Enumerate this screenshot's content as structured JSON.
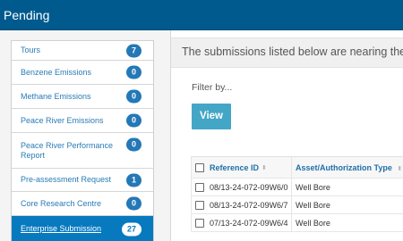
{
  "header": {
    "title": "Pending"
  },
  "sidebar": {
    "items": [
      {
        "label": "Tours",
        "count": "7",
        "active": false
      },
      {
        "label": "Benzene Emissions",
        "count": "0",
        "active": false
      },
      {
        "label": "Methane Emissions",
        "count": "0",
        "active": false
      },
      {
        "label": "Peace River Emissions",
        "count": "0",
        "active": false
      },
      {
        "label": "Peace River Performance Report",
        "count": "0",
        "active": false
      },
      {
        "label": "Pre-assessment Request",
        "count": "1",
        "active": false
      },
      {
        "label": "Core Research Centre",
        "count": "0",
        "active": false
      },
      {
        "label": "Enterprise Submission",
        "count": "27",
        "active": true
      }
    ]
  },
  "main": {
    "notice": "The submissions listed below are nearing the",
    "filter_label": "Filter by...",
    "view_button": "View",
    "table": {
      "columns": [
        "Reference ID",
        "Asset/Authorization Type"
      ],
      "rows": [
        {
          "ref": "08/13-24-072-09W6/0",
          "type": "Well Bore"
        },
        {
          "ref": "08/13-24-072-09W6/7",
          "type": "Well Bore"
        },
        {
          "ref": "07/13-24-072-09W6/4",
          "type": "Well Bore"
        }
      ]
    }
  },
  "icons": {
    "sort": "sort-arrows-icon",
    "checkbox": "checkbox-icon"
  },
  "colors": {
    "header_bg": "#005a8e",
    "badge_bg": "#2478b6",
    "active_item_bg": "#0779bf",
    "view_button_bg": "#44a6c6",
    "link_text": "#2a7bb5"
  }
}
